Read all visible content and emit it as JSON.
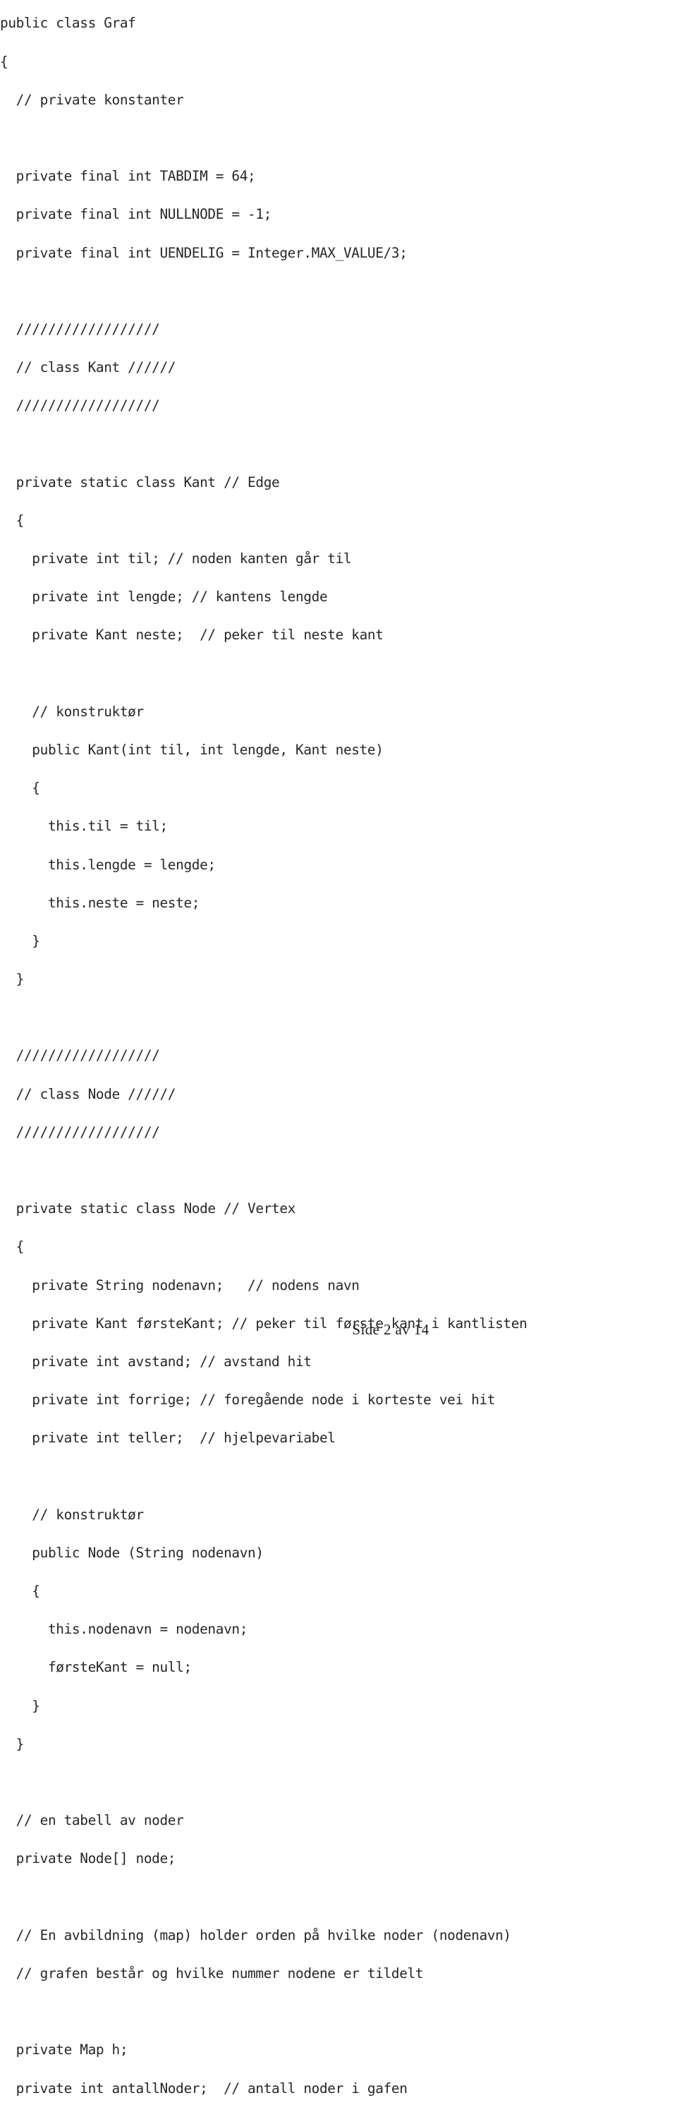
{
  "document": {
    "kind": "source-code-listing",
    "language": "Java",
    "page_footer": "Side 2 av 14",
    "code_lines": [
      "public class Graf",
      "{",
      "  // private konstanter",
      "",
      "  private final int TABDIM = 64;",
      "  private final int NULLNODE = -1;",
      "  private final int UENDELIG = Integer.MAX_VALUE/3;",
      "",
      "  //////////////////",
      "  // class Kant //////",
      "  //////////////////",
      "",
      "  private static class Kant // Edge",
      "  {",
      "    private int til; // noden kanten går til",
      "    private int lengde; // kantens lengde",
      "    private Kant neste;  // peker til neste kant",
      "",
      "    // konstruktør",
      "    public Kant(int til, int lengde, Kant neste)",
      "    {",
      "      this.til = til;",
      "      this.lengde = lengde;",
      "      this.neste = neste;",
      "    }",
      "  }",
      "",
      "  //////////////////",
      "  // class Node //////",
      "  //////////////////",
      "",
      "  private static class Node // Vertex",
      "  {",
      "    private String nodenavn;   // nodens navn",
      "    private Kant førsteKant; // peker til første kant i kantlisten",
      "    private int avstand; // avstand hit",
      "    private int forrige; // foregående node i korteste vei hit",
      "    private int teller;  // hjelpevariabel",
      "",
      "    // konstruktør",
      "    public Node (String nodenavn)",
      "    {",
      "      this.nodenavn = nodenavn;",
      "      førsteKant = null;",
      "    }",
      "  }",
      "",
      "  // en tabell av noder",
      "  private Node[] node;",
      "",
      "  // En avbildning (map) holder orden på hvilke noder (nodenavn)",
      "  // grafen består og hvilke nummer nodene er tildelt",
      "",
      "  private Map h;",
      "  private int antallNoder;  // antall noder i gafen"
    ]
  }
}
